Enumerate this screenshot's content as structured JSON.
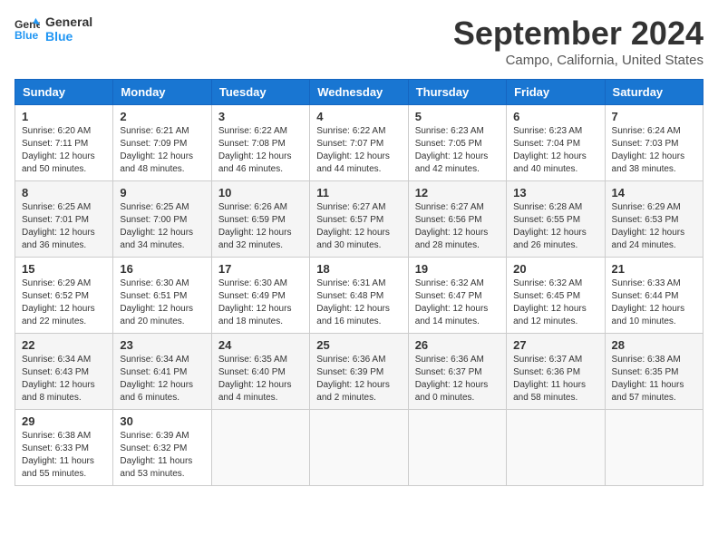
{
  "logo": {
    "line1": "General",
    "line2": "Blue"
  },
  "title": "September 2024",
  "location": "Campo, California, United States",
  "days_of_week": [
    "Sunday",
    "Monday",
    "Tuesday",
    "Wednesday",
    "Thursday",
    "Friday",
    "Saturday"
  ],
  "weeks": [
    [
      {
        "day": "1",
        "info": "Sunrise: 6:20 AM\nSunset: 7:11 PM\nDaylight: 12 hours\nand 50 minutes."
      },
      {
        "day": "2",
        "info": "Sunrise: 6:21 AM\nSunset: 7:09 PM\nDaylight: 12 hours\nand 48 minutes."
      },
      {
        "day": "3",
        "info": "Sunrise: 6:22 AM\nSunset: 7:08 PM\nDaylight: 12 hours\nand 46 minutes."
      },
      {
        "day": "4",
        "info": "Sunrise: 6:22 AM\nSunset: 7:07 PM\nDaylight: 12 hours\nand 44 minutes."
      },
      {
        "day": "5",
        "info": "Sunrise: 6:23 AM\nSunset: 7:05 PM\nDaylight: 12 hours\nand 42 minutes."
      },
      {
        "day": "6",
        "info": "Sunrise: 6:23 AM\nSunset: 7:04 PM\nDaylight: 12 hours\nand 40 minutes."
      },
      {
        "day": "7",
        "info": "Sunrise: 6:24 AM\nSunset: 7:03 PM\nDaylight: 12 hours\nand 38 minutes."
      }
    ],
    [
      {
        "day": "8",
        "info": "Sunrise: 6:25 AM\nSunset: 7:01 PM\nDaylight: 12 hours\nand 36 minutes."
      },
      {
        "day": "9",
        "info": "Sunrise: 6:25 AM\nSunset: 7:00 PM\nDaylight: 12 hours\nand 34 minutes."
      },
      {
        "day": "10",
        "info": "Sunrise: 6:26 AM\nSunset: 6:59 PM\nDaylight: 12 hours\nand 32 minutes."
      },
      {
        "day": "11",
        "info": "Sunrise: 6:27 AM\nSunset: 6:57 PM\nDaylight: 12 hours\nand 30 minutes."
      },
      {
        "day": "12",
        "info": "Sunrise: 6:27 AM\nSunset: 6:56 PM\nDaylight: 12 hours\nand 28 minutes."
      },
      {
        "day": "13",
        "info": "Sunrise: 6:28 AM\nSunset: 6:55 PM\nDaylight: 12 hours\nand 26 minutes."
      },
      {
        "day": "14",
        "info": "Sunrise: 6:29 AM\nSunset: 6:53 PM\nDaylight: 12 hours\nand 24 minutes."
      }
    ],
    [
      {
        "day": "15",
        "info": "Sunrise: 6:29 AM\nSunset: 6:52 PM\nDaylight: 12 hours\nand 22 minutes."
      },
      {
        "day": "16",
        "info": "Sunrise: 6:30 AM\nSunset: 6:51 PM\nDaylight: 12 hours\nand 20 minutes."
      },
      {
        "day": "17",
        "info": "Sunrise: 6:30 AM\nSunset: 6:49 PM\nDaylight: 12 hours\nand 18 minutes."
      },
      {
        "day": "18",
        "info": "Sunrise: 6:31 AM\nSunset: 6:48 PM\nDaylight: 12 hours\nand 16 minutes."
      },
      {
        "day": "19",
        "info": "Sunrise: 6:32 AM\nSunset: 6:47 PM\nDaylight: 12 hours\nand 14 minutes."
      },
      {
        "day": "20",
        "info": "Sunrise: 6:32 AM\nSunset: 6:45 PM\nDaylight: 12 hours\nand 12 minutes."
      },
      {
        "day": "21",
        "info": "Sunrise: 6:33 AM\nSunset: 6:44 PM\nDaylight: 12 hours\nand 10 minutes."
      }
    ],
    [
      {
        "day": "22",
        "info": "Sunrise: 6:34 AM\nSunset: 6:43 PM\nDaylight: 12 hours\nand 8 minutes."
      },
      {
        "day": "23",
        "info": "Sunrise: 6:34 AM\nSunset: 6:41 PM\nDaylight: 12 hours\nand 6 minutes."
      },
      {
        "day": "24",
        "info": "Sunrise: 6:35 AM\nSunset: 6:40 PM\nDaylight: 12 hours\nand 4 minutes."
      },
      {
        "day": "25",
        "info": "Sunrise: 6:36 AM\nSunset: 6:39 PM\nDaylight: 12 hours\nand 2 minutes."
      },
      {
        "day": "26",
        "info": "Sunrise: 6:36 AM\nSunset: 6:37 PM\nDaylight: 12 hours\nand 0 minutes."
      },
      {
        "day": "27",
        "info": "Sunrise: 6:37 AM\nSunset: 6:36 PM\nDaylight: 11 hours\nand 58 minutes."
      },
      {
        "day": "28",
        "info": "Sunrise: 6:38 AM\nSunset: 6:35 PM\nDaylight: 11 hours\nand 57 minutes."
      }
    ],
    [
      {
        "day": "29",
        "info": "Sunrise: 6:38 AM\nSunset: 6:33 PM\nDaylight: 11 hours\nand 55 minutes."
      },
      {
        "day": "30",
        "info": "Sunrise: 6:39 AM\nSunset: 6:32 PM\nDaylight: 11 hours\nand 53 minutes."
      },
      {
        "day": "",
        "info": ""
      },
      {
        "day": "",
        "info": ""
      },
      {
        "day": "",
        "info": ""
      },
      {
        "day": "",
        "info": ""
      },
      {
        "day": "",
        "info": ""
      }
    ]
  ]
}
